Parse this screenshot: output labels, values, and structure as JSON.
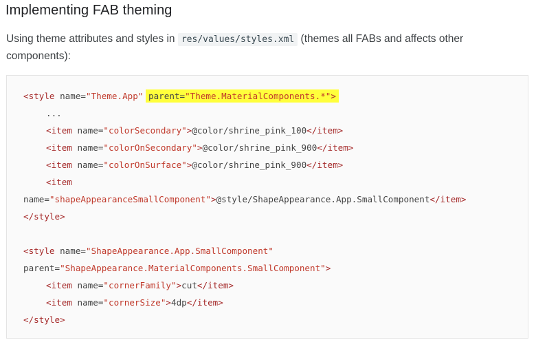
{
  "heading": "Implementing FAB theming",
  "intro": {
    "before": "Using theme attributes and styles in ",
    "code": "res/values/styles.xml",
    "after": " (themes all FABs and affects other components):"
  },
  "code": {
    "line1": {
      "open": "<style ",
      "attr": "name=",
      "value": "\"Theme.App\"",
      "hl_attr": "parent=",
      "hl_value": "\"Theme.MaterialComponents.*\"",
      "close": ">"
    },
    "line2": {
      "text": "..."
    },
    "line3": {
      "open": "<item ",
      "attr": "name=",
      "value": "\"colorSecondary\"",
      "close": ">",
      "content": "@color/shrine_pink_100",
      "end": "</item>"
    },
    "line4": {
      "open": "<item ",
      "attr": "name=",
      "value": "\"colorOnSecondary\"",
      "close": ">",
      "content": "@color/shrine_pink_900",
      "end": "</item>"
    },
    "line5": {
      "open": "<item ",
      "attr": "name=",
      "value": "\"colorOnSurface\"",
      "close": ">",
      "content": "@color/shrine_pink_900",
      "end": "</item>"
    },
    "line6": {
      "open": "<item"
    },
    "line7": {
      "attr": "name=",
      "value": "\"shapeAppearanceSmallComponent\"",
      "close": ">",
      "content": "@style/ShapeAppearance.App.SmallComponent",
      "end": "</item>"
    },
    "line8": {
      "end": "</style>"
    },
    "line10": {
      "open": "<style ",
      "attr": "name=",
      "value": "\"ShapeAppearance.App.SmallComponent\""
    },
    "line11": {
      "attr": "parent=",
      "value": "\"ShapeAppearance.MaterialComponents.SmallComponent\"",
      "close": ">"
    },
    "line12": {
      "open": "<item ",
      "attr": "name=",
      "value": "\"cornerFamily\"",
      "close": ">",
      "content": "cut",
      "end": "</item>"
    },
    "line13": {
      "open": "<item ",
      "attr": "name=",
      "value": "\"cornerSize\"",
      "close": ">",
      "content": "4dp",
      "end": "</item>"
    },
    "line14": {
      "end": "</style>"
    }
  },
  "colors": {
    "highlight": "#ffff3b",
    "tag": "#a52a2a",
    "string": "#c0392b"
  }
}
